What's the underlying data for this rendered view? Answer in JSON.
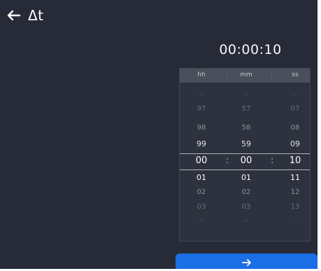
{
  "header": {
    "title": "Δt",
    "back_icon": "arrow-left-icon"
  },
  "time_display": "00:00:10",
  "picker": {
    "headers": {
      "hours": "hh",
      "minutes": "mm",
      "seconds": "ss"
    },
    "separator": ":",
    "rows": [
      {
        "hh": "--",
        "mm": "--",
        "ss": "--"
      },
      {
        "hh": "97",
        "mm": "57",
        "ss": "07"
      },
      {
        "hh": "98",
        "mm": "58",
        "ss": "08"
      },
      {
        "hh": "99",
        "mm": "59",
        "ss": "09"
      },
      {
        "hh": "00",
        "mm": "00",
        "ss": "10"
      },
      {
        "hh": "01",
        "mm": "01",
        "ss": "11"
      },
      {
        "hh": "02",
        "mm": "02",
        "ss": "12"
      },
      {
        "hh": "03",
        "mm": "03",
        "ss": "13"
      },
      {
        "hh": "--",
        "mm": "--",
        "ss": "--"
      }
    ],
    "selected": {
      "hh": "00",
      "mm": "00",
      "ss": "10"
    }
  },
  "next_button": {
    "icon": "arrow-right-icon"
  },
  "colors": {
    "background": "#272b37",
    "accent": "#1b6ee6",
    "picker_bg": "#2d323e"
  }
}
